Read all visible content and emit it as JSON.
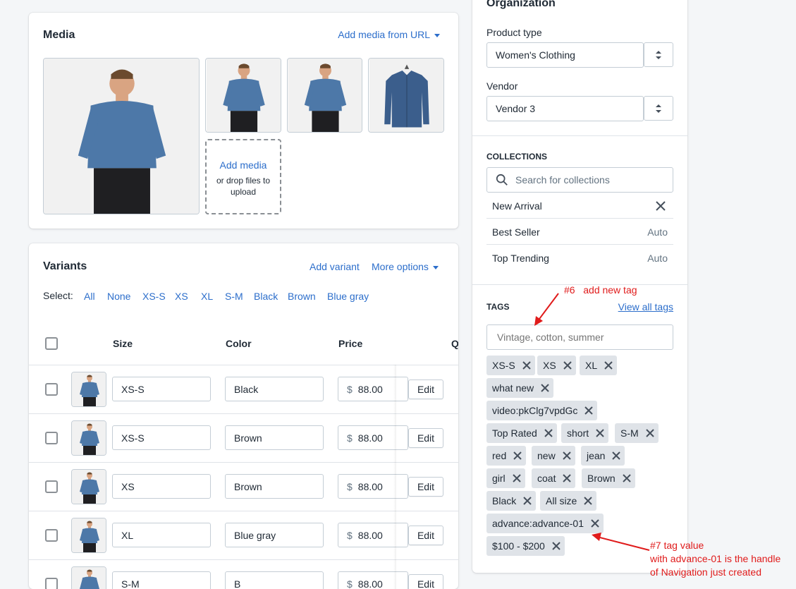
{
  "media": {
    "title": "Media",
    "add_from_url": "Add media from URL",
    "add_media": "Add media",
    "drop_hint": "or drop files to upload"
  },
  "variants": {
    "title": "Variants",
    "add_variant": "Add variant",
    "more_options": "More options",
    "select_label": "Select:",
    "select_options": [
      "All",
      "None",
      "XS-S",
      "XS",
      "XL",
      "S-M",
      "Black",
      "Brown",
      "Blue gray"
    ],
    "columns": {
      "size": "Size",
      "color": "Color",
      "price": "Price",
      "qty": "Q"
    },
    "rows": [
      {
        "size": "XS-S",
        "color": "Black",
        "currency": "$",
        "price": "88.00",
        "edit": "Edit"
      },
      {
        "size": "XS-S",
        "color": "Brown",
        "currency": "$",
        "price": "88.00",
        "edit": "Edit"
      },
      {
        "size": "XS",
        "color": "Brown",
        "currency": "$",
        "price": "88.00",
        "edit": "Edit"
      },
      {
        "size": "XL",
        "color": "Blue gray",
        "currency": "$",
        "price": "88.00",
        "edit": "Edit"
      },
      {
        "size": "S-M",
        "color": "B",
        "currency": "$",
        "price": "88.00",
        "edit": "Edit"
      }
    ]
  },
  "organization": {
    "title": "Organization",
    "product_type_label": "Product type",
    "product_type_value": "Women's Clothing",
    "vendor_label": "Vendor",
    "vendor_value": "Vendor 3"
  },
  "collections": {
    "title": "COLLECTIONS",
    "search_placeholder": "Search for collections",
    "items": [
      {
        "name": "New Arrival",
        "status": ""
      },
      {
        "name": "Best Seller",
        "status": "Auto"
      },
      {
        "name": "Top Trending",
        "status": "Auto"
      }
    ]
  },
  "tags": {
    "title": "TAGS",
    "view_all": "View all tags",
    "placeholder": "Vintage, cotton, summer",
    "items": [
      "XS-S",
      "XS",
      "XL",
      "what new",
      "video:pkClg7vpdGc",
      "Top Rated",
      "short",
      "S-M",
      "red",
      "new",
      "jean",
      "girl",
      "coat",
      "Brown",
      "Black",
      "All size",
      "advance:advance-01",
      "$100 - $200"
    ]
  },
  "annotations": {
    "note6": "#6   add new tag",
    "note7_line1": "#7 tag value",
    "note7_line2": "with advance-01 is the handle",
    "note7_line3": "of Navigation just created",
    "color": "#e01b1b"
  },
  "colors": {
    "accent": "#2c6ecb",
    "tag_bg": "#dfe3e8",
    "page_bg": "#f4f6f8"
  }
}
